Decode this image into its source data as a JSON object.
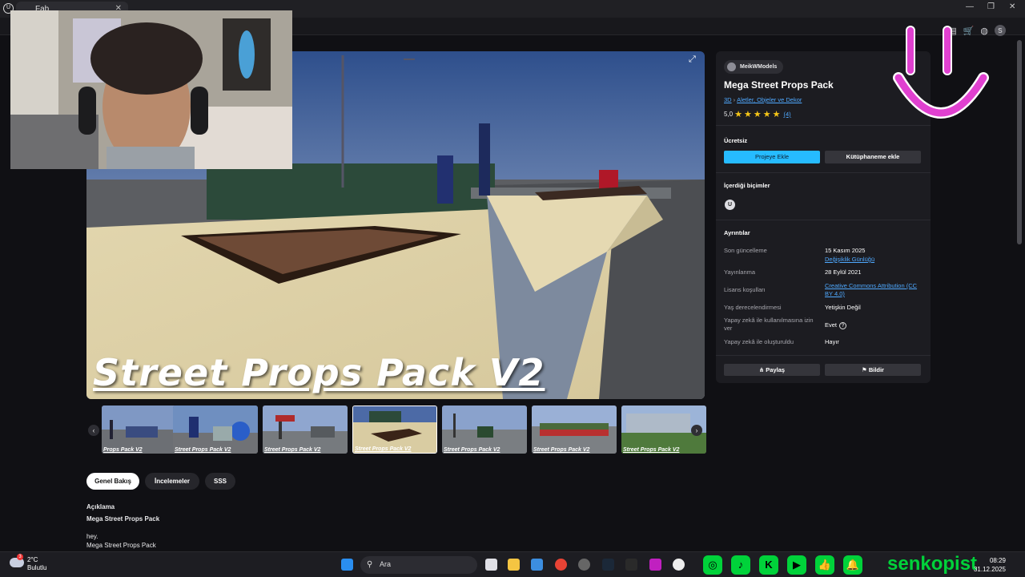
{
  "window": {
    "tab_title": "Fab",
    "app_icon": "unreal-engine-icon",
    "controls": [
      "minimize-icon",
      "restore-icon",
      "close-icon"
    ]
  },
  "navbar": {
    "icons": [
      "notifications-icon",
      "grid-icon",
      "cart-icon",
      "globe-icon"
    ],
    "avatar_initial": "s"
  },
  "hero": {
    "title": "Street Props Pack V2",
    "expand_icon": "expand-icon"
  },
  "thumbnails": [
    {
      "label": "Props Pack V2",
      "active": false
    },
    {
      "label": "Street Props Pack V2",
      "active": false
    },
    {
      "label": "Street Props Pack V2",
      "active": false
    },
    {
      "label": "Street Props Pack V2",
      "active": true
    },
    {
      "label": "Street Props Pack V2",
      "active": false
    },
    {
      "label": "Street Props Pack V2",
      "active": false
    },
    {
      "label": "Street Props Pack V2",
      "active": false
    }
  ],
  "content_tabs": [
    {
      "label": "Genel Bakış",
      "active": true
    },
    {
      "label": "İncelemeler",
      "active": false
    },
    {
      "label": "SSS",
      "active": false
    }
  ],
  "description": {
    "heading": "Açıklama",
    "title": "Mega Street Props Pack",
    "lines": [
      "hey.",
      "Mega Street Props Pack"
    ]
  },
  "product": {
    "seller": "MeikWModels",
    "title": "Mega Street Props Pack",
    "breadcrumb": [
      "3D",
      "Aletler, Objeler ve Dekor"
    ],
    "rating": "5,0",
    "stars": 5,
    "review_count": "(4)",
    "price_label": "Ücretsiz",
    "add_to_project": "Projeye Ekle",
    "add_to_library": "Kütüphaneme ekle",
    "formats_heading": "İçerdiği biçimler",
    "format_icon": "unreal-engine-icon",
    "details_heading": "Ayrıntılar",
    "details": [
      {
        "key": "Son güncelleme",
        "value": "15 Kasım 2025",
        "link": "Değişiklik Günlüğü"
      },
      {
        "key": "Yayınlanma",
        "value": "28 Eylül 2021"
      },
      {
        "key": "Lisans koşulları",
        "link": "Creative Commons Attribution (CC BY 4.0)"
      },
      {
        "key": "Yaş derecelendirmesi",
        "value": "Yetişkin Değil"
      },
      {
        "key": "Yapay zekâ ile kullanılmasına izin ver",
        "value": "Evet"
      },
      {
        "key": "Yapay zekâ ile oluşturuldu",
        "value": "Hayır"
      }
    ],
    "share_label": "Paylaş",
    "report_label": "Bildir"
  },
  "taskbar": {
    "weather_temp": "2°C",
    "weather_desc": "Bulutlu",
    "weather_badge": "3",
    "search_placeholder": "Ara",
    "social_icons": [
      "instagram-icon",
      "tiktok-icon",
      "kick-icon",
      "youtube-icon",
      "thumbs-up-icon",
      "bell-icon"
    ],
    "brand": "senkopist",
    "time": "08:29",
    "date": "31.12.2025"
  },
  "colors": {
    "accent": "#26bbff",
    "link": "#4fa9ff",
    "star": "#f5c518",
    "overlay_green": "#00d23a",
    "overlay_pink": "#e040d0"
  }
}
